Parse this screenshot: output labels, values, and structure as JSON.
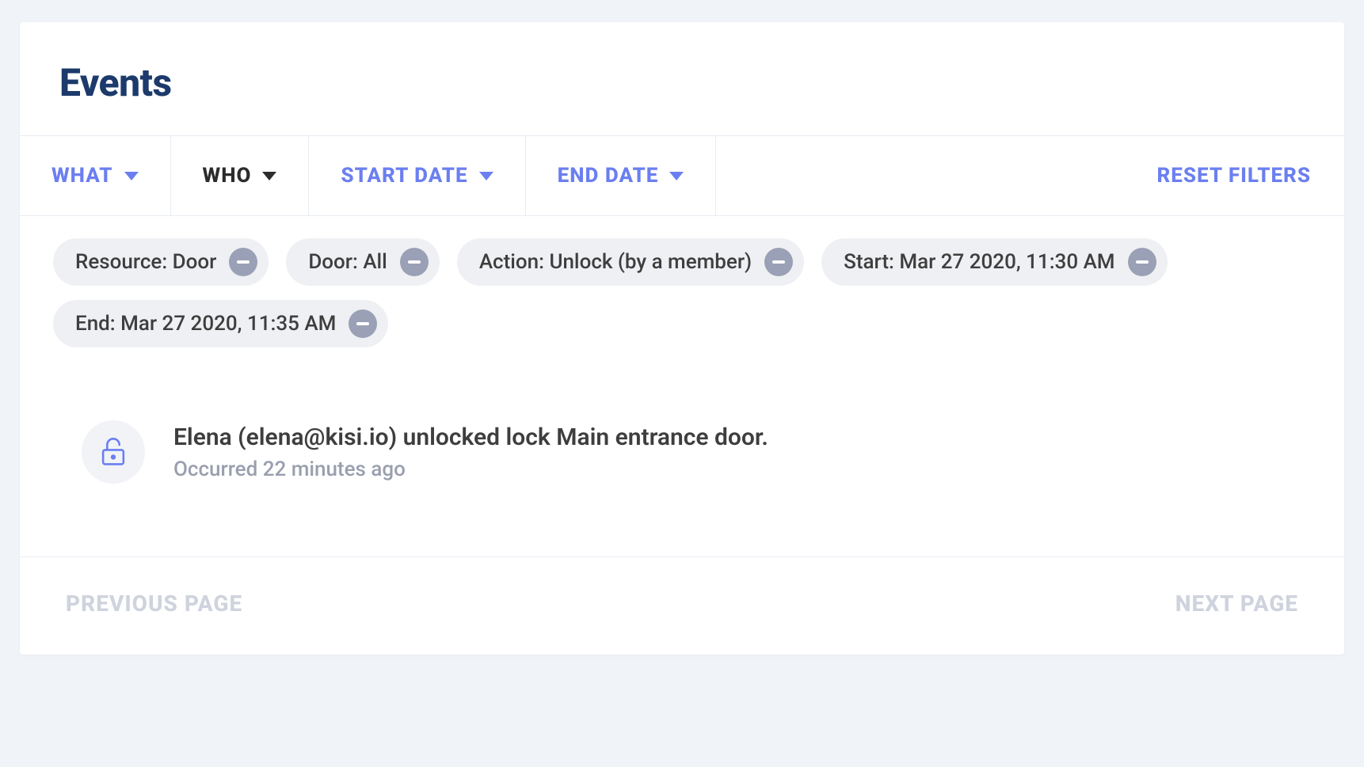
{
  "page": {
    "title": "Events"
  },
  "filters": {
    "tabs": {
      "what": "WHAT",
      "who": "WHO",
      "start_date": "START DATE",
      "end_date": "END DATE"
    },
    "reset_label": "RESET FILTERS",
    "active_tab": "who"
  },
  "chips": [
    {
      "label": "Resource: Door"
    },
    {
      "label": "Door: All"
    },
    {
      "label": "Action: Unlock (by a member)"
    },
    {
      "label": "Start: Mar 27 2020, 11:30 AM"
    },
    {
      "label": "End: Mar 27 2020, 11:35 AM"
    }
  ],
  "events": [
    {
      "icon": "unlock-icon",
      "title": "Elena (elena@kisi.io) unlocked lock Main entrance door.",
      "occurred": "Occurred 22 minutes ago"
    }
  ],
  "pagination": {
    "prev": "PREVIOUS PAGE",
    "next": "NEXT PAGE"
  }
}
